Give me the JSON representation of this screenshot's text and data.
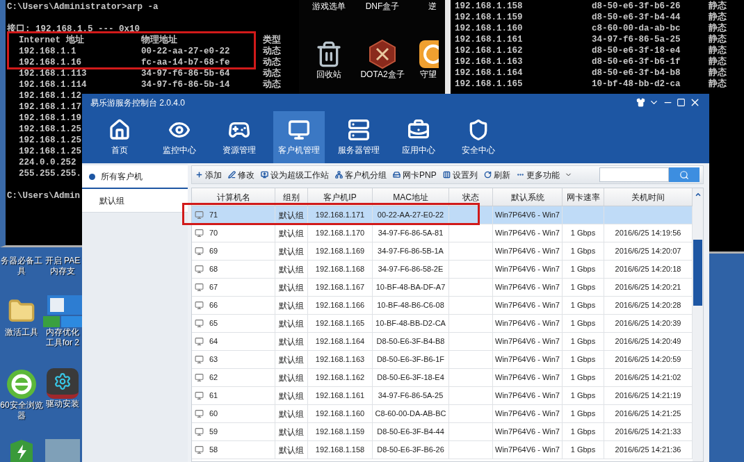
{
  "cmd_left": {
    "prompt": "C:\\Users\\Administrator>arp -a",
    "interface": "接口: 192.168.1.5 --- 0x10",
    "headers": [
      "Internet 地址",
      "物理地址",
      "类型"
    ],
    "entries": [
      {
        "ip": "192.168.1.1",
        "mac": "00-22-aa-27-e0-22",
        "type": "动态"
      },
      {
        "ip": "192.168.1.16",
        "mac": "fc-aa-14-b7-68-fe",
        "type": "动态"
      },
      {
        "ip": "192.168.1.113",
        "mac": "34-97-f6-86-5b-64",
        "type": "动态"
      },
      {
        "ip": "192.168.1.114",
        "mac": "34-97-f6-86-5b-14",
        "type": "动态"
      },
      {
        "ip": "192.168.1.12"
      },
      {
        "ip": "192.168.1.17"
      },
      {
        "ip": "192.168.1.19"
      },
      {
        "ip": "192.168.1.25"
      },
      {
        "ip": "192.168.1.25"
      },
      {
        "ip": "192.168.1.25"
      },
      {
        "ip": "224.0.0.252"
      },
      {
        "ip": "255.255.255."
      }
    ],
    "prompt_end": "C:\\Users\\Admin"
  },
  "cmd_right": {
    "entries": [
      {
        "ip": "192.168.1.158",
        "mac": "d8-50-e6-3f-b6-26",
        "type": "静态"
      },
      {
        "ip": "192.168.1.159",
        "mac": "d8-50-e6-3f-b4-44",
        "type": "静态"
      },
      {
        "ip": "192.168.1.160",
        "mac": "c8-60-00-da-ab-bc",
        "type": "静态"
      },
      {
        "ip": "192.168.1.161",
        "mac": "34-97-f6-86-5a-25",
        "type": "静态"
      },
      {
        "ip": "192.168.1.162",
        "mac": "d8-50-e6-3f-18-e4",
        "type": "静态"
      },
      {
        "ip": "192.168.1.163",
        "mac": "d8-50-e6-3f-b6-1f",
        "type": "静态"
      },
      {
        "ip": "192.168.1.164",
        "mac": "d8-50-e6-3f-b4-b8",
        "type": "静态"
      },
      {
        "ip": "192.168.1.165",
        "mac": "10-bf-48-bb-d2-ca",
        "type": "静态"
      }
    ]
  },
  "desktop_icons": [
    {
      "label_lines": [
        "游戏选单"
      ]
    },
    {
      "label_lines": [
        "DNF盒子"
      ]
    },
    {
      "label_lines": [
        "逆"
      ]
    },
    {
      "label_lines": [
        "回收站"
      ]
    },
    {
      "label_lines": [
        "DOTA2盒子"
      ]
    },
    {
      "label_lines": [
        "守望"
      ]
    },
    {
      "label_lines": [
        "务器必备工",
        "具"
      ]
    },
    {
      "label_lines": [
        "开启 PAE",
        "内存支"
      ]
    },
    {
      "label_lines": [
        "激活工具"
      ]
    },
    {
      "label_lines": [
        "内存优化",
        "工具for 2"
      ]
    },
    {
      "label_lines": [
        "60安全浏览",
        "器"
      ]
    },
    {
      "label_lines": [
        "驱动安装"
      ]
    }
  ],
  "app": {
    "title": "易乐游服务控制台 2.0.4.0",
    "nav": [
      {
        "label": "首页",
        "selected": false
      },
      {
        "label": "监控中心",
        "selected": false
      },
      {
        "label": "资源管理",
        "selected": false
      },
      {
        "label": "客户机管理",
        "selected": true
      },
      {
        "label": "服务器管理",
        "selected": false
      },
      {
        "label": "应用中心",
        "selected": false
      },
      {
        "label": "安全中心",
        "selected": false
      }
    ],
    "groups": [
      {
        "label": "所有客户机",
        "selected": true
      },
      {
        "label": "默认组",
        "selected": false
      }
    ],
    "toolbar": [
      {
        "label": "添加",
        "dropdown": false
      },
      {
        "label": "修改",
        "dropdown": false
      },
      {
        "label": "设为超级工作站",
        "dropdown": false
      },
      {
        "label": "客户机分组",
        "dropdown": false
      },
      {
        "label": "网卡PNP",
        "dropdown": false
      },
      {
        "label": "设置列",
        "dropdown": false
      },
      {
        "label": "刷新",
        "dropdown": false
      },
      {
        "label": "更多功能",
        "dropdown": true
      }
    ],
    "table": {
      "columns": [
        "计算机名",
        "组别",
        "客户机IP",
        "MAC地址",
        "状态",
        "默认系统",
        "网卡速率",
        "关机时间"
      ],
      "rows": [
        {
          "selected": true,
          "cells": [
            "71",
            "默认组",
            "192.168.1.171",
            "00-22-AA-27-E0-22",
            "",
            "Win7P64V6 - Win7",
            "",
            ""
          ]
        },
        {
          "selected": false,
          "cells": [
            "70",
            "默认组",
            "192.168.1.170",
            "34-97-F6-86-5A-81",
            "",
            "Win7P64V6 - Win7",
            "1 Gbps",
            "2016/6/25 14:19:56"
          ]
        },
        {
          "selected": false,
          "cells": [
            "69",
            "默认组",
            "192.168.1.169",
            "34-97-F6-86-5B-1A",
            "",
            "Win7P64V6 - Win7",
            "1 Gbps",
            "2016/6/25 14:20:07"
          ]
        },
        {
          "selected": false,
          "cells": [
            "68",
            "默认组",
            "192.168.1.168",
            "34-97-F6-86-58-2E",
            "",
            "Win7P64V6 - Win7",
            "1 Gbps",
            "2016/6/25 14:20:18"
          ]
        },
        {
          "selected": false,
          "cells": [
            "67",
            "默认组",
            "192.168.1.167",
            "10-BF-48-BA-DF-A7",
            "",
            "Win7P64V6 - Win7",
            "1 Gbps",
            "2016/6/25 14:20:21"
          ]
        },
        {
          "selected": false,
          "cells": [
            "66",
            "默认组",
            "192.168.1.166",
            "10-BF-48-B6-C6-08",
            "",
            "Win7P64V6 - Win7",
            "1 Gbps",
            "2016/6/25 14:20:28"
          ]
        },
        {
          "selected": false,
          "cells": [
            "65",
            "默认组",
            "192.168.1.165",
            "10-BF-48-BB-D2-CA",
            "",
            "Win7P64V6 - Win7",
            "1 Gbps",
            "2016/6/25 14:20:39"
          ]
        },
        {
          "selected": false,
          "cells": [
            "64",
            "默认组",
            "192.168.1.164",
            "D8-50-E6-3F-B4-B8",
            "",
            "Win7P64V6 - Win7",
            "1 Gbps",
            "2016/6/25 14:20:49"
          ]
        },
        {
          "selected": false,
          "cells": [
            "63",
            "默认组",
            "192.168.1.163",
            "D8-50-E6-3F-B6-1F",
            "",
            "Win7P64V6 - Win7",
            "1 Gbps",
            "2016/6/25 14:20:59"
          ]
        },
        {
          "selected": false,
          "cells": [
            "62",
            "默认组",
            "192.168.1.162",
            "D8-50-E6-3F-18-E4",
            "",
            "Win7P64V6 - Win7",
            "1 Gbps",
            "2016/6/25 14:21:02"
          ]
        },
        {
          "selected": false,
          "cells": [
            "61",
            "默认组",
            "192.168.1.161",
            "34-97-F6-86-5A-25",
            "",
            "Win7P64V6 - Win7",
            "1 Gbps",
            "2016/6/25 14:21:19"
          ]
        },
        {
          "selected": false,
          "cells": [
            "60",
            "默认组",
            "192.168.1.160",
            "C8-60-00-DA-AB-BC",
            "",
            "Win7P64V6 - Win7",
            "1 Gbps",
            "2016/6/25 14:21:25"
          ]
        },
        {
          "selected": false,
          "cells": [
            "59",
            "默认组",
            "192.168.1.159",
            "D8-50-E6-3F-B4-44",
            "",
            "Win7P64V6 - Win7",
            "1 Gbps",
            "2016/6/25 14:21:33"
          ]
        },
        {
          "selected": false,
          "cells": [
            "58",
            "默认组",
            "192.168.1.158",
            "D8-50-E6-3F-B6-26",
            "",
            "Win7P64V6 - Win7",
            "1 Gbps",
            "2016/6/25 14:21:36"
          ]
        }
      ]
    }
  }
}
